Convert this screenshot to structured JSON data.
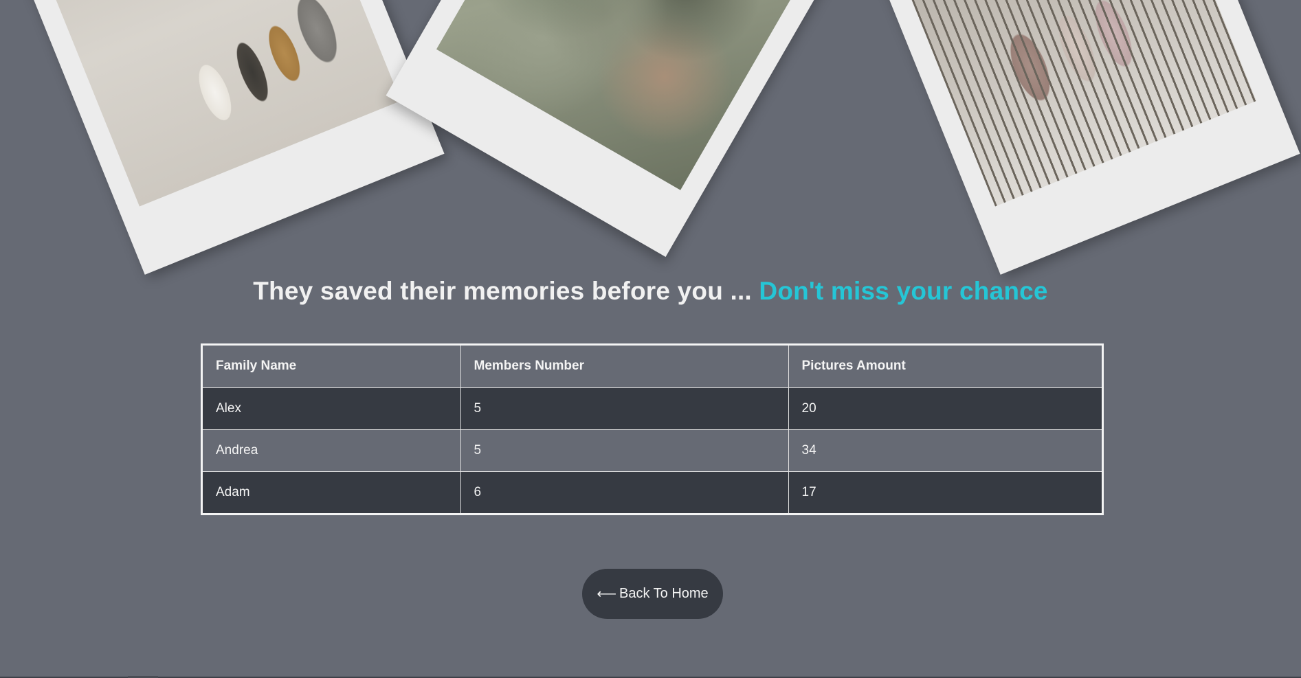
{
  "headline": {
    "main": "They saved their memories before you ... ",
    "accent": "Don't miss your chance"
  },
  "table": {
    "headers": [
      "Family Name",
      "Members Number",
      "Pictures Amount"
    ],
    "rows": [
      [
        "Alex",
        "5",
        "20"
      ],
      [
        "Andrea",
        "5",
        "34"
      ],
      [
        "Adam",
        "6",
        "17"
      ]
    ]
  },
  "back_button": {
    "arrow": "⟵",
    "label": "Back To Home"
  },
  "colors": {
    "background": "#666a74",
    "accent": "#25c6d6",
    "dark_row": "#363a42"
  }
}
